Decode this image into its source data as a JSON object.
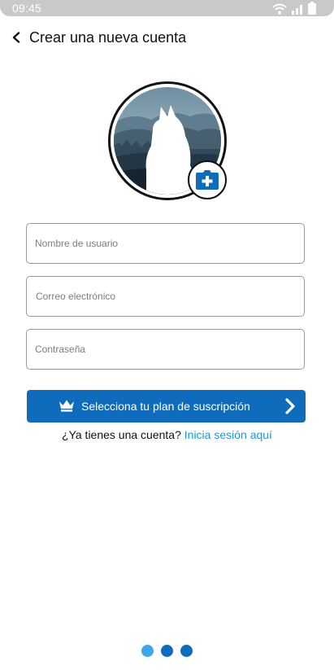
{
  "status_bar": {
    "time": "09:45"
  },
  "header": {
    "title": "Crear una nueva cuenta"
  },
  "form": {
    "username_placeholder": "Nombre de usuario",
    "email_placeholder": "Correo electrónico",
    "password_placeholder": "Contraseña"
  },
  "cta": {
    "label": "Selecciona tu plan de suscripción"
  },
  "login": {
    "prompt": "¿Ya tienes una cuenta?",
    "link": "Inicia sesión aquí"
  },
  "pagination": {
    "total": 3,
    "current": 1
  },
  "colors": {
    "accent": "#0f6cbd",
    "link": "#1c9ad6",
    "dot_active": "#3fa6ea",
    "status_bar": "#c9c9c9"
  },
  "icons": [
    "back-chevron-icon",
    "wifi-icon",
    "signal-icon",
    "battery-icon",
    "camera-add-icon",
    "crown-icon",
    "chevron-right-icon"
  ]
}
